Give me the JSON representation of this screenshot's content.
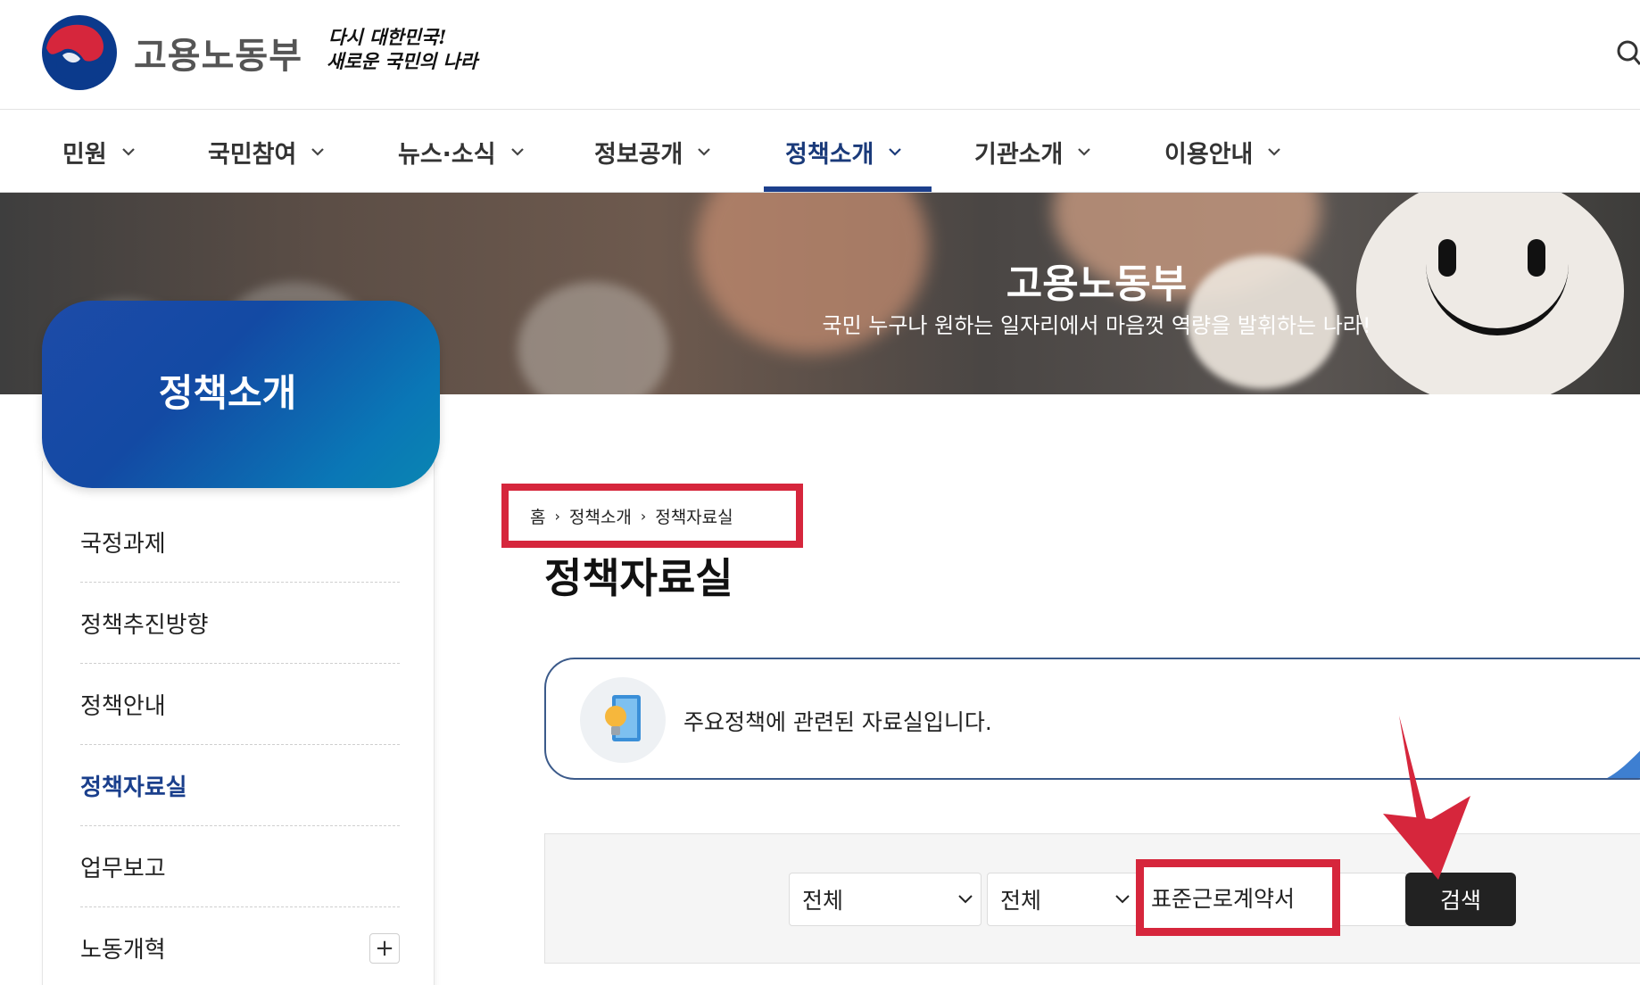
{
  "header": {
    "brand": "고용노동부",
    "slogan_line1": "다시 대한민국!",
    "slogan_line2": "새로운 국민의 나라",
    "logo_icon": "taegeuk-logo-icon",
    "search_icon": "search-icon"
  },
  "nav": {
    "items": [
      {
        "label": "민원"
      },
      {
        "label": "국민참여"
      },
      {
        "label": "뉴스·소식"
      },
      {
        "label": "정보공개"
      },
      {
        "label": "정책소개",
        "active": true
      },
      {
        "label": "기관소개"
      },
      {
        "label": "이용안내"
      }
    ]
  },
  "banner": {
    "title": "고용노동부",
    "subtitle": "국민 누구나 원하는 일자리에서 마음껏 역량을 발휘하는 나라!"
  },
  "sidebar": {
    "title": "정책소개",
    "items": [
      {
        "label": "국정과제"
      },
      {
        "label": "정책추진방향"
      },
      {
        "label": "정책안내"
      },
      {
        "label": "정책자료실",
        "active": true
      },
      {
        "label": "업무보고"
      },
      {
        "label": "노동개혁",
        "expand": "+"
      }
    ]
  },
  "breadcrumb": {
    "home": "홈",
    "level1": "정책소개",
    "level2": "정책자료실",
    "separator": "›"
  },
  "page": {
    "title": "정책자료실"
  },
  "info": {
    "text": "주요정책에 관련된 자료실입니다."
  },
  "search": {
    "select1": "전체",
    "select2": "전체",
    "keyword": "표준근로계약서",
    "button": "검색"
  },
  "colors": {
    "accent_navy": "#1c3f8c",
    "highlight_red": "#d6263c",
    "search_button": "#222222"
  }
}
